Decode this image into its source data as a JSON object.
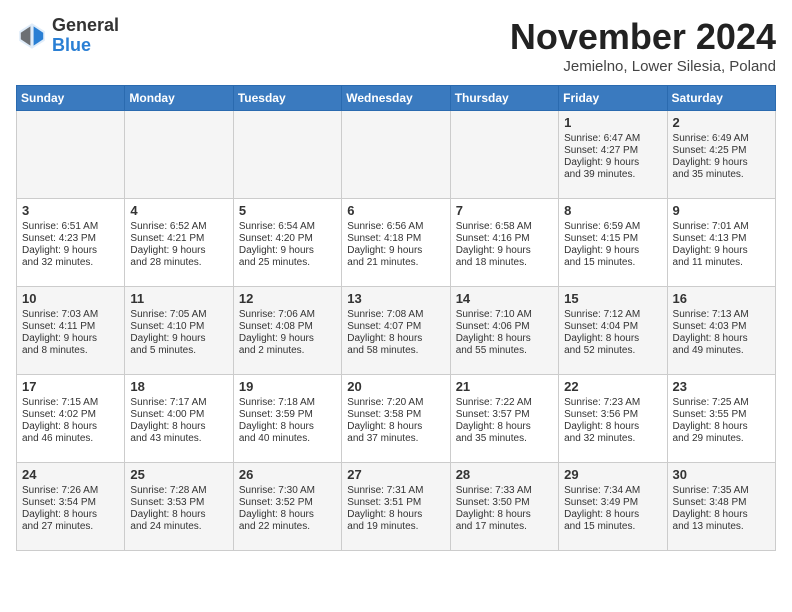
{
  "header": {
    "logo_general": "General",
    "logo_blue": "Blue",
    "month_title": "November 2024",
    "location": "Jemielno, Lower Silesia, Poland"
  },
  "weekdays": [
    "Sunday",
    "Monday",
    "Tuesday",
    "Wednesday",
    "Thursday",
    "Friday",
    "Saturday"
  ],
  "weeks": [
    [
      {
        "day": "",
        "info": ""
      },
      {
        "day": "",
        "info": ""
      },
      {
        "day": "",
        "info": ""
      },
      {
        "day": "",
        "info": ""
      },
      {
        "day": "",
        "info": ""
      },
      {
        "day": "1",
        "info": "Sunrise: 6:47 AM\nSunset: 4:27 PM\nDaylight: 9 hours\nand 39 minutes."
      },
      {
        "day": "2",
        "info": "Sunrise: 6:49 AM\nSunset: 4:25 PM\nDaylight: 9 hours\nand 35 minutes."
      }
    ],
    [
      {
        "day": "3",
        "info": "Sunrise: 6:51 AM\nSunset: 4:23 PM\nDaylight: 9 hours\nand 32 minutes."
      },
      {
        "day": "4",
        "info": "Sunrise: 6:52 AM\nSunset: 4:21 PM\nDaylight: 9 hours\nand 28 minutes."
      },
      {
        "day": "5",
        "info": "Sunrise: 6:54 AM\nSunset: 4:20 PM\nDaylight: 9 hours\nand 25 minutes."
      },
      {
        "day": "6",
        "info": "Sunrise: 6:56 AM\nSunset: 4:18 PM\nDaylight: 9 hours\nand 21 minutes."
      },
      {
        "day": "7",
        "info": "Sunrise: 6:58 AM\nSunset: 4:16 PM\nDaylight: 9 hours\nand 18 minutes."
      },
      {
        "day": "8",
        "info": "Sunrise: 6:59 AM\nSunset: 4:15 PM\nDaylight: 9 hours\nand 15 minutes."
      },
      {
        "day": "9",
        "info": "Sunrise: 7:01 AM\nSunset: 4:13 PM\nDaylight: 9 hours\nand 11 minutes."
      }
    ],
    [
      {
        "day": "10",
        "info": "Sunrise: 7:03 AM\nSunset: 4:11 PM\nDaylight: 9 hours\nand 8 minutes."
      },
      {
        "day": "11",
        "info": "Sunrise: 7:05 AM\nSunset: 4:10 PM\nDaylight: 9 hours\nand 5 minutes."
      },
      {
        "day": "12",
        "info": "Sunrise: 7:06 AM\nSunset: 4:08 PM\nDaylight: 9 hours\nand 2 minutes."
      },
      {
        "day": "13",
        "info": "Sunrise: 7:08 AM\nSunset: 4:07 PM\nDaylight: 8 hours\nand 58 minutes."
      },
      {
        "day": "14",
        "info": "Sunrise: 7:10 AM\nSunset: 4:06 PM\nDaylight: 8 hours\nand 55 minutes."
      },
      {
        "day": "15",
        "info": "Sunrise: 7:12 AM\nSunset: 4:04 PM\nDaylight: 8 hours\nand 52 minutes."
      },
      {
        "day": "16",
        "info": "Sunrise: 7:13 AM\nSunset: 4:03 PM\nDaylight: 8 hours\nand 49 minutes."
      }
    ],
    [
      {
        "day": "17",
        "info": "Sunrise: 7:15 AM\nSunset: 4:02 PM\nDaylight: 8 hours\nand 46 minutes."
      },
      {
        "day": "18",
        "info": "Sunrise: 7:17 AM\nSunset: 4:00 PM\nDaylight: 8 hours\nand 43 minutes."
      },
      {
        "day": "19",
        "info": "Sunrise: 7:18 AM\nSunset: 3:59 PM\nDaylight: 8 hours\nand 40 minutes."
      },
      {
        "day": "20",
        "info": "Sunrise: 7:20 AM\nSunset: 3:58 PM\nDaylight: 8 hours\nand 37 minutes."
      },
      {
        "day": "21",
        "info": "Sunrise: 7:22 AM\nSunset: 3:57 PM\nDaylight: 8 hours\nand 35 minutes."
      },
      {
        "day": "22",
        "info": "Sunrise: 7:23 AM\nSunset: 3:56 PM\nDaylight: 8 hours\nand 32 minutes."
      },
      {
        "day": "23",
        "info": "Sunrise: 7:25 AM\nSunset: 3:55 PM\nDaylight: 8 hours\nand 29 minutes."
      }
    ],
    [
      {
        "day": "24",
        "info": "Sunrise: 7:26 AM\nSunset: 3:54 PM\nDaylight: 8 hours\nand 27 minutes."
      },
      {
        "day": "25",
        "info": "Sunrise: 7:28 AM\nSunset: 3:53 PM\nDaylight: 8 hours\nand 24 minutes."
      },
      {
        "day": "26",
        "info": "Sunrise: 7:30 AM\nSunset: 3:52 PM\nDaylight: 8 hours\nand 22 minutes."
      },
      {
        "day": "27",
        "info": "Sunrise: 7:31 AM\nSunset: 3:51 PM\nDaylight: 8 hours\nand 19 minutes."
      },
      {
        "day": "28",
        "info": "Sunrise: 7:33 AM\nSunset: 3:50 PM\nDaylight: 8 hours\nand 17 minutes."
      },
      {
        "day": "29",
        "info": "Sunrise: 7:34 AM\nSunset: 3:49 PM\nDaylight: 8 hours\nand 15 minutes."
      },
      {
        "day": "30",
        "info": "Sunrise: 7:35 AM\nSunset: 3:48 PM\nDaylight: 8 hours\nand 13 minutes."
      }
    ]
  ]
}
